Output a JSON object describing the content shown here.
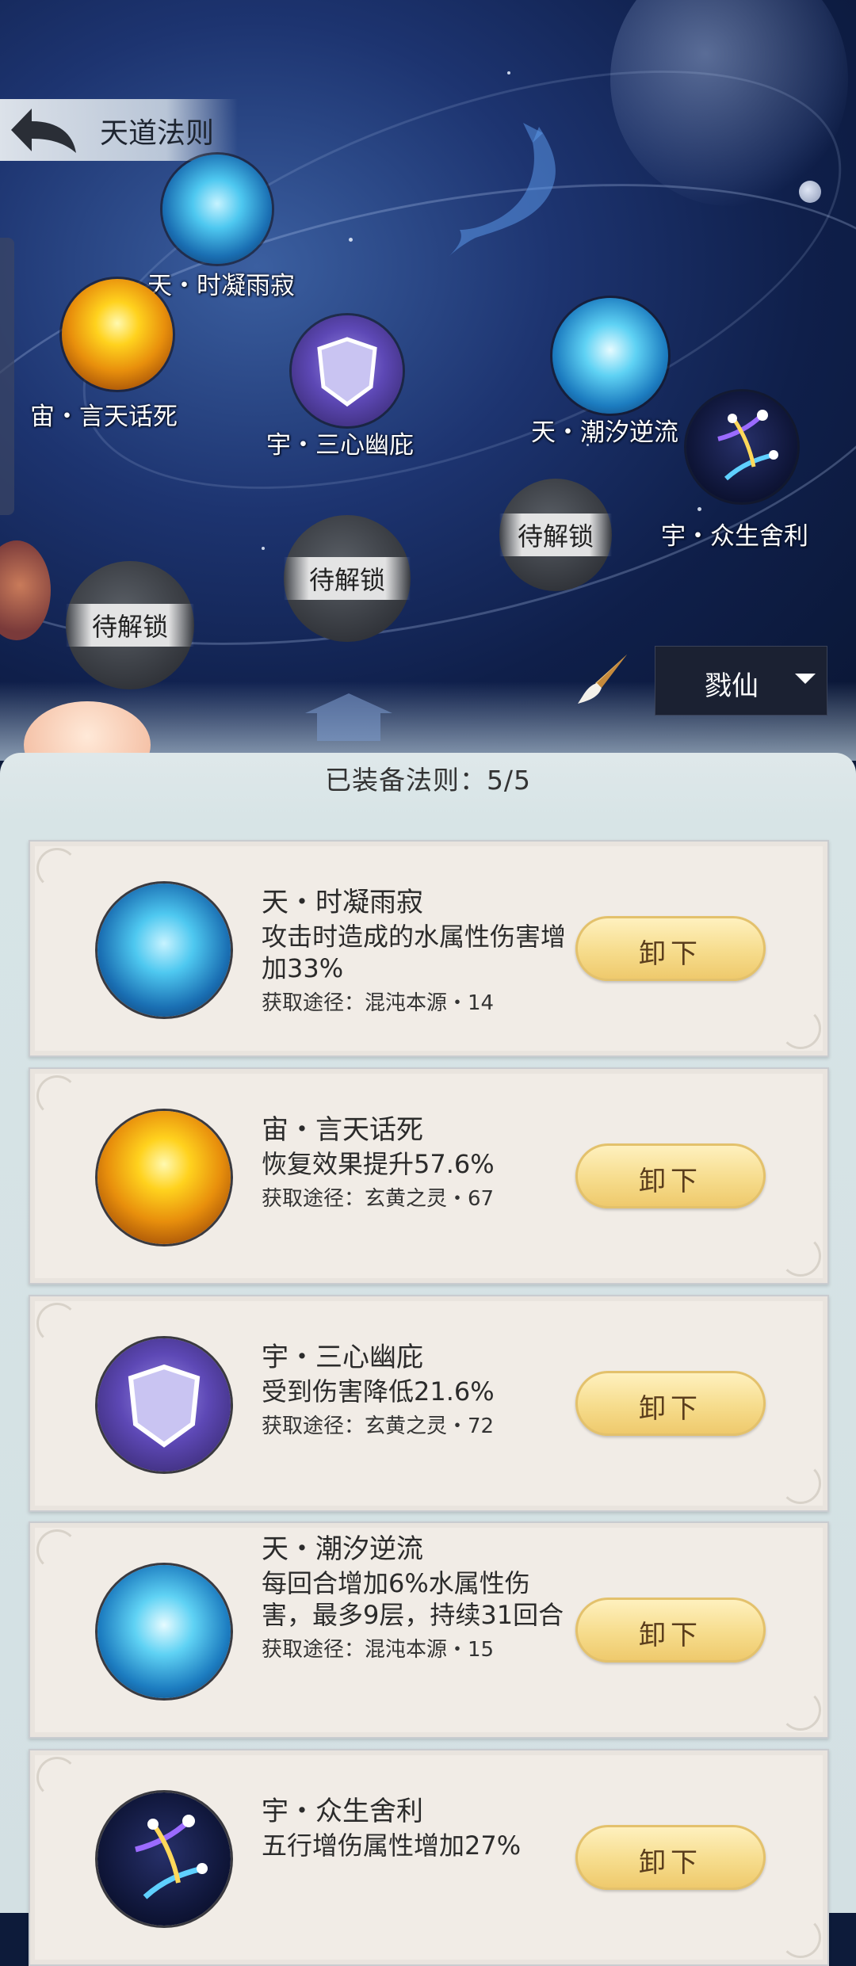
{
  "header": {
    "title": "天道法则"
  },
  "map": {
    "nodes": [
      {
        "label": "天・时凝雨寂",
        "icon": "water-drop-icon"
      },
      {
        "label": "宙・言天话死",
        "icon": "golden-light-icon"
      },
      {
        "label": "宇・三心幽庇",
        "icon": "shield-icon"
      },
      {
        "label": "天・潮汐逆流",
        "icon": "tide-wave-icon"
      },
      {
        "label": "宇・众生舍利",
        "icon": "comet-icon"
      }
    ],
    "locked_label": "待解锁",
    "dropdown_value": "戮仙"
  },
  "panel": {
    "equipped_label": "已装备法则：5/5",
    "unequip_label": "卸下",
    "cards": [
      {
        "name": "天・时凝雨寂",
        "desc": "攻击时造成的水属性伤害增加33%",
        "source": "获取途径：混沌本源・14",
        "icon": "water-drop-icon"
      },
      {
        "name": "宙・言天话死",
        "desc": "恢复效果提升57.6%",
        "source": "获取途径：玄黄之灵・67",
        "icon": "golden-light-icon"
      },
      {
        "name": "宇・三心幽庇",
        "desc": "受到伤害降低21.6%",
        "source": "获取途径：玄黄之灵・72",
        "icon": "shield-icon"
      },
      {
        "name": "天・潮汐逆流",
        "desc": "每回合增加6%水属性伤害，最多9层，持续31回合",
        "source": "获取途径：混沌本源・15",
        "icon": "tide-wave-icon"
      },
      {
        "name": "宇・众生舍利",
        "desc": "五行增伤属性增加27%",
        "source": "",
        "icon": "comet-icon"
      }
    ]
  }
}
